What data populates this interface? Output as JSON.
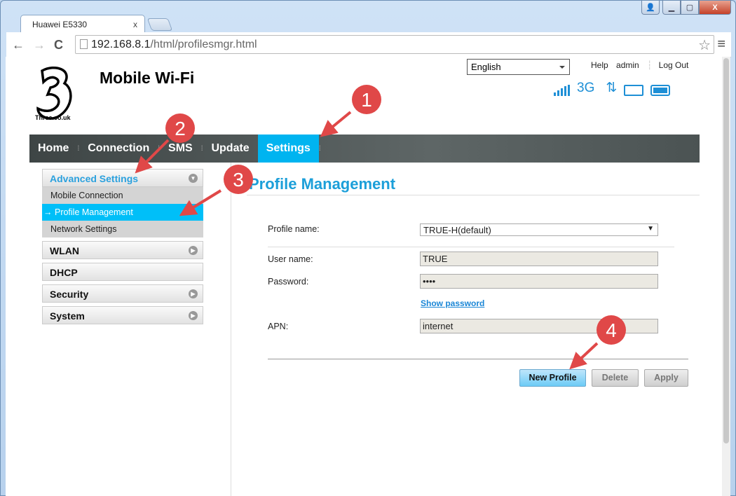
{
  "browser": {
    "tab_title": "Huawei E5330",
    "url_host": "192.168.8.1",
    "url_path": "/html/profilesmgr.html"
  },
  "header": {
    "logo_text": "Three.co.uk",
    "title": "Mobile Wi-Fi",
    "language": "English",
    "links": [
      "Help",
      "admin",
      "Log Out"
    ],
    "network_type": "3G"
  },
  "nav": {
    "items": [
      "Home",
      "Connection",
      "SMS",
      "Update",
      "Settings"
    ],
    "active": "Settings"
  },
  "sidebar": {
    "advanced": {
      "label": "Advanced Settings",
      "items": [
        "Mobile Connection",
        "Profile Management",
        "Network Settings"
      ],
      "active_prefix": "→"
    },
    "sections": [
      "WLAN",
      "DHCP",
      "Security",
      "System"
    ]
  },
  "main": {
    "title": "Profile Management",
    "profile_name_label": "Profile name:",
    "profile_name_value": "TRUE-H(default)",
    "user_name_label": "User name:",
    "user_name_value": "TRUE",
    "password_label": "Password:",
    "password_value": "••••",
    "show_password": "Show password",
    "apn_label": "APN:",
    "apn_value": "internet",
    "buttons": {
      "new": "New Profile",
      "delete": "Delete",
      "apply": "Apply"
    }
  },
  "annotations": [
    "1",
    "2",
    "3",
    "4"
  ],
  "colors": {
    "accent": "#00b4f0",
    "title": "#1c9fd9",
    "annotation": "#e04848"
  }
}
